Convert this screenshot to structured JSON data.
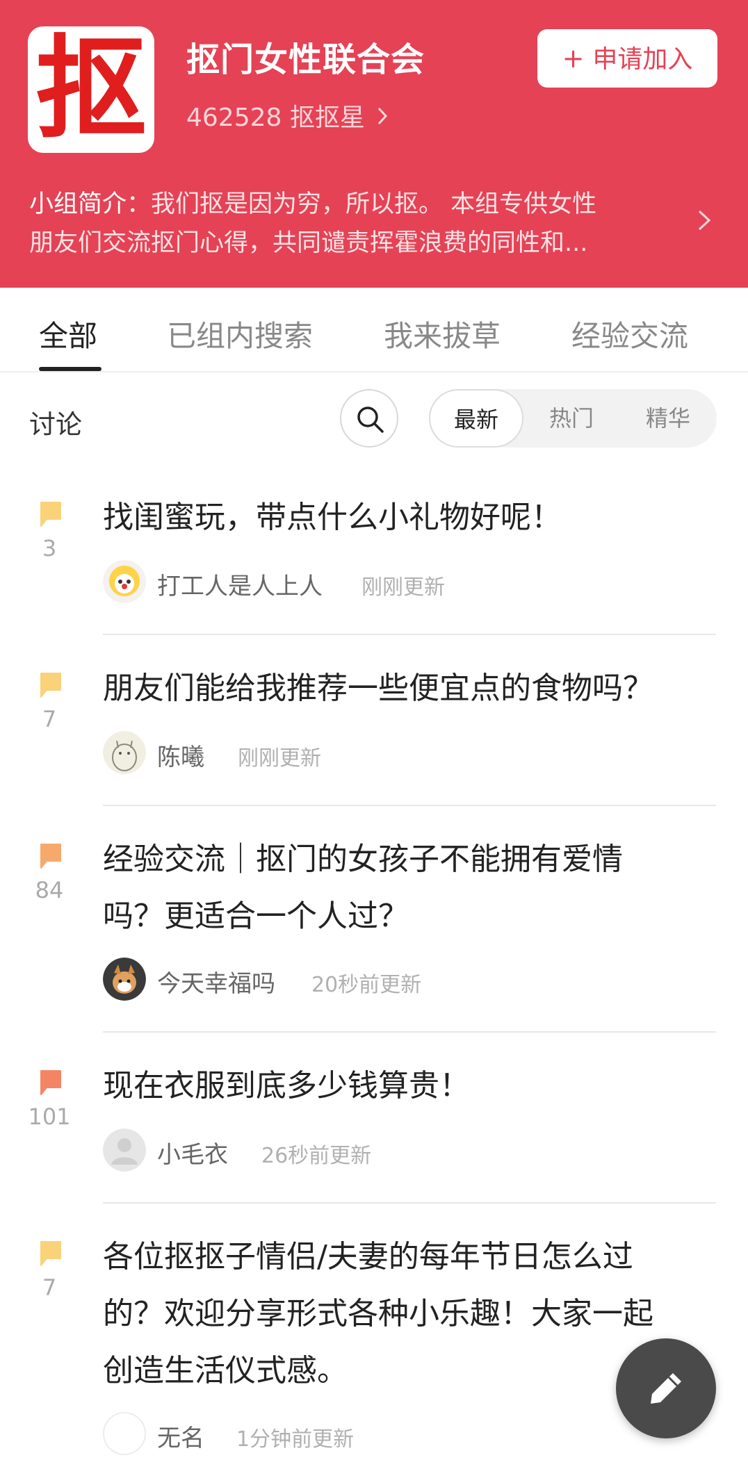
{
  "header": {
    "logo_char": "抠",
    "group_name": "抠门女性联合会",
    "member_count": "462528",
    "member_label": "抠抠星",
    "join_label": "申请加入",
    "intro_label": "小组简介：",
    "intro_line1": "我们抠是因为穷，所以抠。  本组专供女性",
    "intro_line2": "朋友们交流抠门心得，共同谴责挥霍浪费的同性和...",
    "brand_color": "#e54255"
  },
  "tabs": [
    "全部",
    "已组内搜索",
    "我来拔草",
    "经验交流"
  ],
  "toolbar": {
    "discussion_label": "讨论",
    "sort_options": [
      "最新",
      "热门",
      "精华"
    ]
  },
  "posts": [
    {
      "count": "3",
      "title_lines": [
        "找闺蜜玩，带点什么小礼物好呢！"
      ],
      "author": "打工人是人上人",
      "time": "刚刚更新",
      "bubble_color": "#f9d27a"
    },
    {
      "count": "7",
      "title_lines": [
        "朋友们能给我推荐一些便宜点的食物吗？"
      ],
      "author": "陈曦",
      "time": "刚刚更新",
      "bubble_color": "#f9d27a"
    },
    {
      "count": "84",
      "title_lines": [
        "经验交流｜抠门的女孩子不能拥有爱情",
        "吗？更适合一个人过？"
      ],
      "author": "今天幸福吗",
      "time": "20秒前更新",
      "bubble_color": "#f7a96b"
    },
    {
      "count": "101",
      "title_lines": [
        "现在衣服到底多少钱算贵！"
      ],
      "author": "小毛衣",
      "time": "26秒前更新",
      "bubble_color": "#f58464"
    },
    {
      "count": "7",
      "title_lines": [
        "各位抠抠子情侣/夫妻的每年节日怎么过",
        "的？欢迎分享形式各种小乐趣！大家一起",
        "创造生活仪式感。"
      ],
      "author": "无名",
      "time": "1分钟前更新",
      "bubble_color": "#f9d27a"
    }
  ]
}
